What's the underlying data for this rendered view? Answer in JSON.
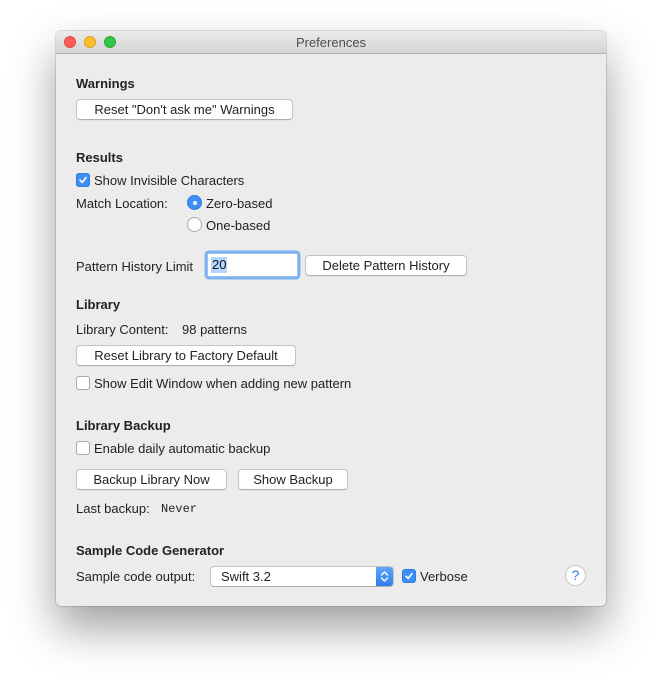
{
  "window": {
    "title": "Preferences",
    "controls": [
      "close",
      "minimize",
      "zoom"
    ]
  },
  "warnings": {
    "heading": "Warnings",
    "reset_button": "Reset \"Don't ask me\" Warnings"
  },
  "results": {
    "heading": "Results",
    "show_invisible": {
      "label": "Show Invisible Characters",
      "checked": true
    },
    "match_location": {
      "label": "Match Location:",
      "options": [
        {
          "label": "Zero-based",
          "selected": true
        },
        {
          "label": "One-based",
          "selected": false
        }
      ]
    },
    "pattern_history": {
      "label": "Pattern History Limit",
      "value": "20",
      "delete_button": "Delete Pattern History"
    }
  },
  "library": {
    "heading": "Library",
    "content_label": "Library Content:",
    "content_value": "98 patterns",
    "reset_button": "Reset Library to Factory Default",
    "show_edit_window": {
      "label": "Show Edit Window when adding new pattern",
      "checked": false
    }
  },
  "backup": {
    "heading": "Library Backup",
    "enable_daily": {
      "label": "Enable daily automatic backup",
      "checked": false
    },
    "backup_now_button": "Backup Library Now",
    "show_backup_button": "Show Backup",
    "last_backup_label": "Last backup:",
    "last_backup_value": "Never"
  },
  "sample_code": {
    "heading": "Sample Code Generator",
    "output_label": "Sample code output:",
    "output_value": "Swift 3.2",
    "verbose": {
      "label": "Verbose",
      "checked": true
    },
    "help_glyph": "?"
  },
  "colors": {
    "accent": "#3d8ef5",
    "window_bg": "#ececec",
    "close": "#fc5f57",
    "minimize": "#fdbc2e",
    "zoom": "#33c748"
  }
}
